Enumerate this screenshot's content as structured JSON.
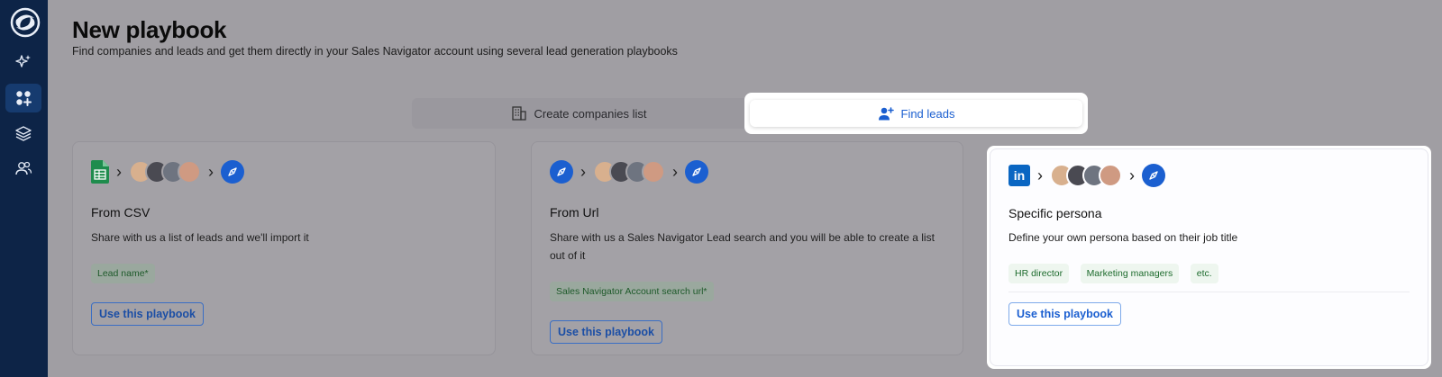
{
  "header": {
    "title": "New playbook",
    "subtitle": "Find companies and leads and get them directly in your Sales Navigator account using several lead generation playbooks"
  },
  "tabs": [
    {
      "label": "Create companies list",
      "icon": "building-icon",
      "active": false
    },
    {
      "label": "Find leads",
      "icon": "user-plus-icon",
      "active": true
    }
  ],
  "sidebar": {
    "items": [
      {
        "icon": "sparkles-icon",
        "active": false
      },
      {
        "icon": "grid-plus-icon",
        "active": true
      },
      {
        "icon": "layers-icon",
        "active": false
      },
      {
        "icon": "users-icon",
        "active": false
      }
    ]
  },
  "cards": [
    {
      "title": "From CSV",
      "description": "Share with us a list of leads and we'll import it",
      "tags": [
        "Lead name*"
      ],
      "button": "Use this playbook",
      "source_icon": "google-sheets-icon",
      "selected": false
    },
    {
      "title": "From Url",
      "description": "Share with us a Sales Navigator Lead search and you will be able to create a list out of it",
      "tags": [
        "Sales Navigator Account search url*"
      ],
      "button": "Use this playbook",
      "source_icon": "compass-icon",
      "selected": false
    },
    {
      "title": "Specific persona",
      "description": "Define your own persona based on their job title",
      "tags": [
        "HR director",
        "Marketing managers",
        "etc."
      ],
      "button": "Use this playbook",
      "source_icon": "linkedin-icon",
      "selected": true
    }
  ],
  "colors": {
    "sidebar": "#0d2447",
    "accent": "#1b5fd0",
    "tag_text": "#1d6b2d"
  }
}
